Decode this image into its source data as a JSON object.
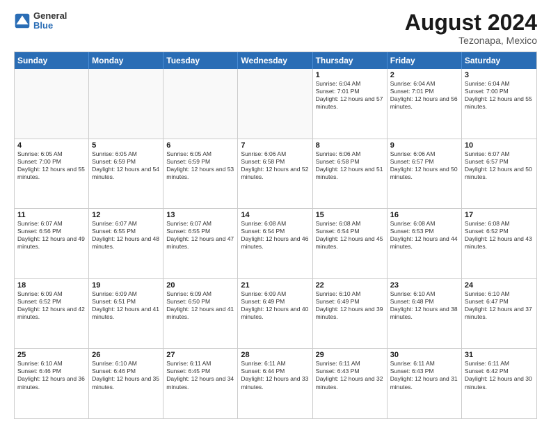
{
  "header": {
    "logo_line1": "General",
    "logo_line2": "Blue",
    "month_year": "August 2024",
    "location": "Tezonapa, Mexico"
  },
  "days_of_week": [
    "Sunday",
    "Monday",
    "Tuesday",
    "Wednesday",
    "Thursday",
    "Friday",
    "Saturday"
  ],
  "rows": [
    {
      "cells": [
        {
          "day": "",
          "empty": true
        },
        {
          "day": "",
          "empty": true
        },
        {
          "day": "",
          "empty": true
        },
        {
          "day": "",
          "empty": true
        },
        {
          "day": "1",
          "sunrise": "6:04 AM",
          "sunset": "7:01 PM",
          "daylight": "12 hours and 57 minutes."
        },
        {
          "day": "2",
          "sunrise": "6:04 AM",
          "sunset": "7:01 PM",
          "daylight": "12 hours and 56 minutes."
        },
        {
          "day": "3",
          "sunrise": "6:04 AM",
          "sunset": "7:00 PM",
          "daylight": "12 hours and 55 minutes."
        }
      ]
    },
    {
      "cells": [
        {
          "day": "4",
          "sunrise": "6:05 AM",
          "sunset": "7:00 PM",
          "daylight": "12 hours and 55 minutes."
        },
        {
          "day": "5",
          "sunrise": "6:05 AM",
          "sunset": "6:59 PM",
          "daylight": "12 hours and 54 minutes."
        },
        {
          "day": "6",
          "sunrise": "6:05 AM",
          "sunset": "6:59 PM",
          "daylight": "12 hours and 53 minutes."
        },
        {
          "day": "7",
          "sunrise": "6:06 AM",
          "sunset": "6:58 PM",
          "daylight": "12 hours and 52 minutes."
        },
        {
          "day": "8",
          "sunrise": "6:06 AM",
          "sunset": "6:58 PM",
          "daylight": "12 hours and 51 minutes."
        },
        {
          "day": "9",
          "sunrise": "6:06 AM",
          "sunset": "6:57 PM",
          "daylight": "12 hours and 50 minutes."
        },
        {
          "day": "10",
          "sunrise": "6:07 AM",
          "sunset": "6:57 PM",
          "daylight": "12 hours and 50 minutes."
        }
      ]
    },
    {
      "cells": [
        {
          "day": "11",
          "sunrise": "6:07 AM",
          "sunset": "6:56 PM",
          "daylight": "12 hours and 49 minutes."
        },
        {
          "day": "12",
          "sunrise": "6:07 AM",
          "sunset": "6:55 PM",
          "daylight": "12 hours and 48 minutes."
        },
        {
          "day": "13",
          "sunrise": "6:07 AM",
          "sunset": "6:55 PM",
          "daylight": "12 hours and 47 minutes."
        },
        {
          "day": "14",
          "sunrise": "6:08 AM",
          "sunset": "6:54 PM",
          "daylight": "12 hours and 46 minutes."
        },
        {
          "day": "15",
          "sunrise": "6:08 AM",
          "sunset": "6:54 PM",
          "daylight": "12 hours and 45 minutes."
        },
        {
          "day": "16",
          "sunrise": "6:08 AM",
          "sunset": "6:53 PM",
          "daylight": "12 hours and 44 minutes."
        },
        {
          "day": "17",
          "sunrise": "6:08 AM",
          "sunset": "6:52 PM",
          "daylight": "12 hours and 43 minutes."
        }
      ]
    },
    {
      "cells": [
        {
          "day": "18",
          "sunrise": "6:09 AM",
          "sunset": "6:52 PM",
          "daylight": "12 hours and 42 minutes."
        },
        {
          "day": "19",
          "sunrise": "6:09 AM",
          "sunset": "6:51 PM",
          "daylight": "12 hours and 41 minutes."
        },
        {
          "day": "20",
          "sunrise": "6:09 AM",
          "sunset": "6:50 PM",
          "daylight": "12 hours and 41 minutes."
        },
        {
          "day": "21",
          "sunrise": "6:09 AM",
          "sunset": "6:49 PM",
          "daylight": "12 hours and 40 minutes."
        },
        {
          "day": "22",
          "sunrise": "6:10 AM",
          "sunset": "6:49 PM",
          "daylight": "12 hours and 39 minutes."
        },
        {
          "day": "23",
          "sunrise": "6:10 AM",
          "sunset": "6:48 PM",
          "daylight": "12 hours and 38 minutes."
        },
        {
          "day": "24",
          "sunrise": "6:10 AM",
          "sunset": "6:47 PM",
          "daylight": "12 hours and 37 minutes."
        }
      ]
    },
    {
      "cells": [
        {
          "day": "25",
          "sunrise": "6:10 AM",
          "sunset": "6:46 PM",
          "daylight": "12 hours and 36 minutes."
        },
        {
          "day": "26",
          "sunrise": "6:10 AM",
          "sunset": "6:46 PM",
          "daylight": "12 hours and 35 minutes."
        },
        {
          "day": "27",
          "sunrise": "6:11 AM",
          "sunset": "6:45 PM",
          "daylight": "12 hours and 34 minutes."
        },
        {
          "day": "28",
          "sunrise": "6:11 AM",
          "sunset": "6:44 PM",
          "daylight": "12 hours and 33 minutes."
        },
        {
          "day": "29",
          "sunrise": "6:11 AM",
          "sunset": "6:43 PM",
          "daylight": "12 hours and 32 minutes."
        },
        {
          "day": "30",
          "sunrise": "6:11 AM",
          "sunset": "6:43 PM",
          "daylight": "12 hours and 31 minutes."
        },
        {
          "day": "31",
          "sunrise": "6:11 AM",
          "sunset": "6:42 PM",
          "daylight": "12 hours and 30 minutes."
        }
      ]
    }
  ]
}
